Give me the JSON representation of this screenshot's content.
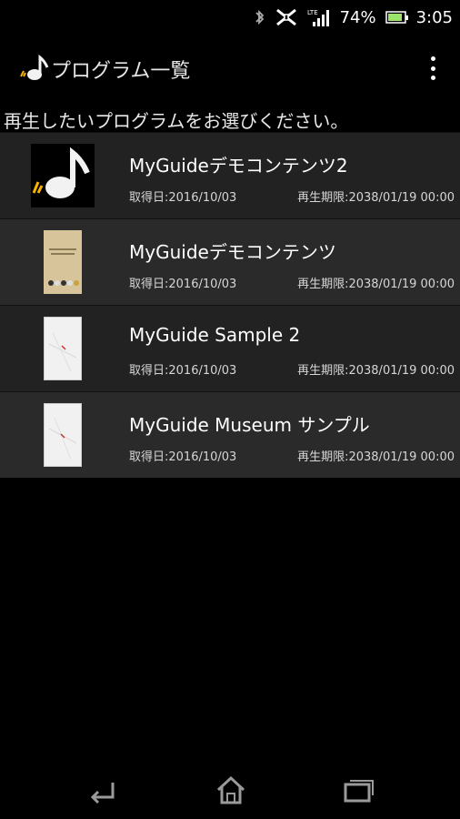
{
  "status_bar": {
    "icons": [
      "bluetooth-icon",
      "nfc-icon",
      "lte-signal-icon",
      "battery-icon"
    ],
    "network": "LTE",
    "battery": "74%",
    "time": "3:05"
  },
  "action_bar": {
    "title": "プログラム一覧",
    "app_icon": "music-note-icon",
    "menu_icon": "overflow-menu-icon"
  },
  "prompt": "再生したいプログラムをお選びください。",
  "programs": [
    {
      "title": "MyGuideデモコンテンツ2",
      "acquired": "取得日:2016/10/03",
      "expires": "再生期限:2038/01/19 00:00",
      "thumb": "music-note"
    },
    {
      "title": "MyGuideデモコンテンツ",
      "acquired": "取得日:2016/10/03",
      "expires": "再生期限:2038/01/19 00:00",
      "thumb": "beige-cover"
    },
    {
      "title": "MyGuide Sample 2",
      "acquired": "取得日:2016/10/03",
      "expires": "再生期限:2038/01/19 00:00",
      "thumb": "paper-cover"
    },
    {
      "title": "MyGuide Museum サンプル",
      "acquired": "取得日:2016/10/03",
      "expires": "再生期限:2038/01/19 00:00",
      "thumb": "paper-cover"
    }
  ],
  "nav_bar": {
    "buttons": [
      "back-icon",
      "home-icon",
      "recents-icon"
    ]
  },
  "colors": {
    "background": "#000000",
    "row_odd": "#222222",
    "row_even": "#2a2a2a",
    "accent": "#ffcc00"
  }
}
